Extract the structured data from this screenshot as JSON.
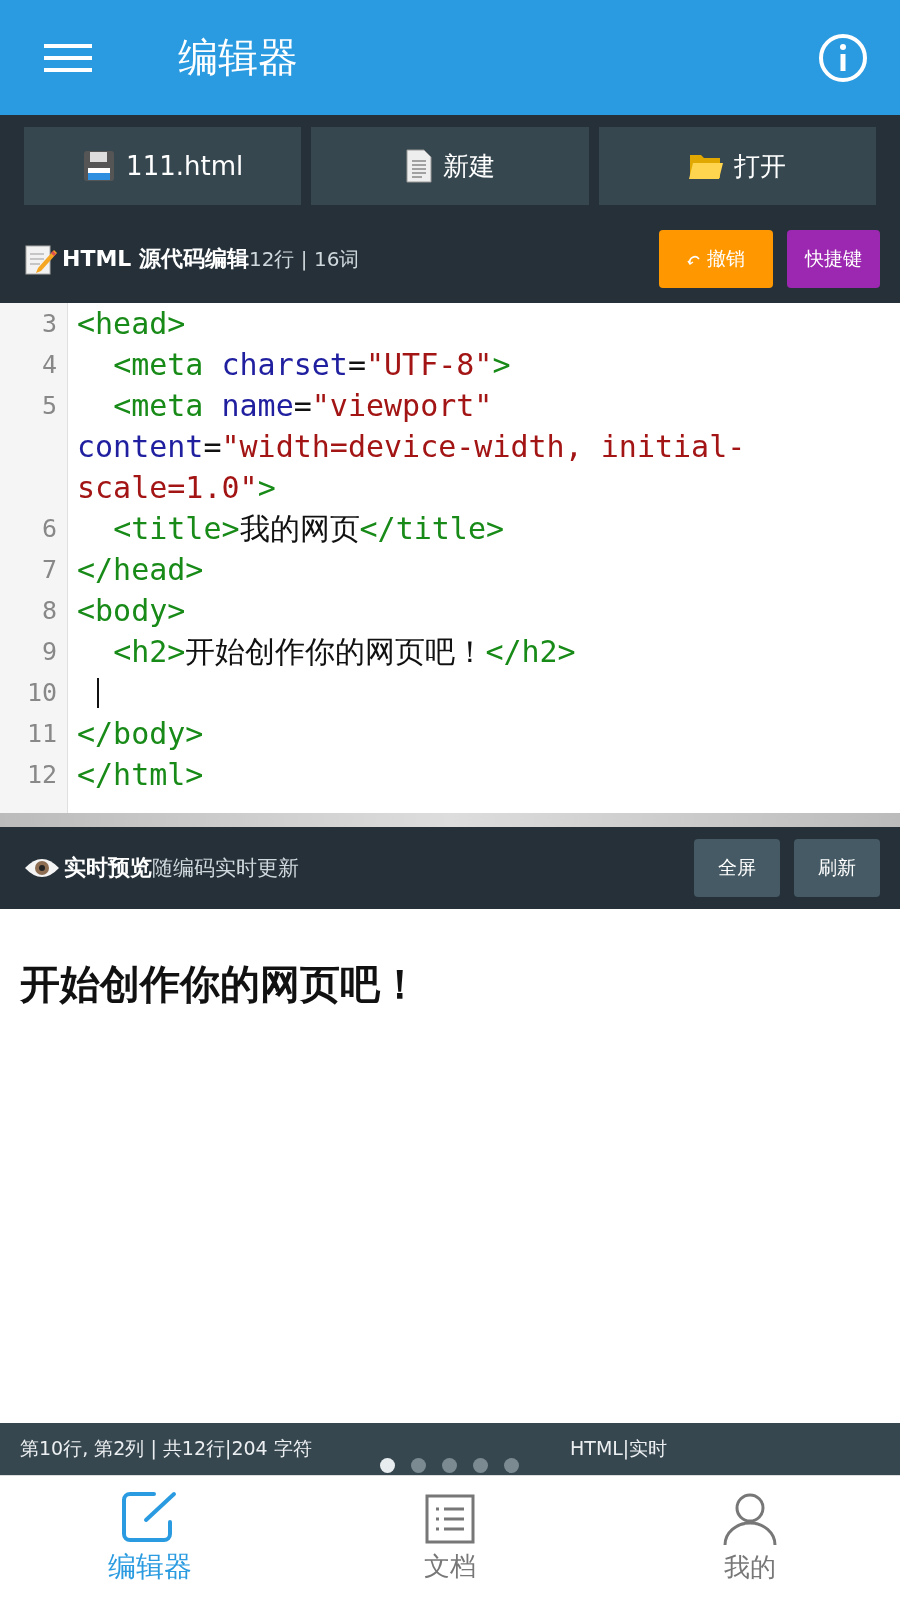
{
  "app_bar": {
    "title": "编辑器"
  },
  "toolbar": [
    {
      "label": "111.html",
      "kind": "save"
    },
    {
      "label": "新建",
      "kind": "new"
    },
    {
      "label": "打开",
      "kind": "open"
    }
  ],
  "editor": {
    "title": "HTML 源代码编辑",
    "stats": "12行 | 16词",
    "actions": [
      {
        "label": "撤销",
        "kind": "undo"
      },
      {
        "label": "快捷键",
        "kind": "shortcuts"
      }
    ],
    "lines": [
      {
        "number": "3",
        "cursor": false,
        "tokens": [
          {
            "kind": "tag",
            "text": "<head>"
          }
        ]
      },
      {
        "number": "4",
        "cursor": false,
        "tokens": [
          {
            "kind": "tag",
            "text": "  <meta"
          },
          {
            "kind": "attr",
            "text": " charset"
          },
          {
            "kind": "text",
            "text": "="
          },
          {
            "kind": "str",
            "text": "\"UTF-8\""
          },
          {
            "kind": "tag",
            "text": ">"
          }
        ]
      },
      {
        "number": "5",
        "cursor": false,
        "tokens": [
          {
            "kind": "tag",
            "text": "  <meta"
          },
          {
            "kind": "attr",
            "text": " name"
          },
          {
            "kind": "text",
            "text": "="
          },
          {
            "kind": "str",
            "text": "\"viewport\""
          },
          {
            "kind": "attr",
            "text": " content"
          },
          {
            "kind": "text",
            "text": "="
          },
          {
            "kind": "str",
            "text": "\"width=device-width, initial-scale=1.0\""
          },
          {
            "kind": "tag",
            "text": ">"
          }
        ]
      },
      {
        "number": "6",
        "cursor": false,
        "tokens": [
          {
            "kind": "tag",
            "text": "  <title>"
          },
          {
            "kind": "text",
            "text": "我的网页"
          },
          {
            "kind": "tag",
            "text": "</title>"
          }
        ]
      },
      {
        "number": "7",
        "cursor": false,
        "tokens": [
          {
            "kind": "tag",
            "text": "</head>"
          }
        ]
      },
      {
        "number": "8",
        "cursor": false,
        "tokens": [
          {
            "kind": "tag",
            "text": "<body>"
          }
        ]
      },
      {
        "number": "9",
        "cursor": false,
        "tokens": [
          {
            "kind": "tag",
            "text": "  <h2>"
          },
          {
            "kind": "text",
            "text": "开始创作你的网页吧！"
          },
          {
            "kind": "tag",
            "text": "</h2>"
          }
        ]
      },
      {
        "number": "10",
        "cursor": true
      },
      {
        "number": "11",
        "cursor": false,
        "tokens": [
          {
            "kind": "tag",
            "text": "</body>"
          }
        ]
      },
      {
        "number": "12",
        "cursor": false,
        "tokens": [
          {
            "kind": "tag",
            "text": "</html>"
          }
        ]
      }
    ]
  },
  "preview": {
    "title": "实时预览",
    "subtitle": "随编码实时更新",
    "actions": [
      "全屏",
      "刷新"
    ],
    "heading": "开始创作你的网页吧！"
  },
  "status_bar": {
    "position": "第10行, 第2列 | 共12行|204 字符",
    "mode": "HTML|实时"
  },
  "pager": [
    {
      "selected": true
    },
    {
      "selected": false
    },
    {
      "selected": false
    },
    {
      "selected": false
    },
    {
      "selected": false
    }
  ],
  "nav": [
    {
      "label": "编辑器",
      "kind": "editor",
      "selected": true
    },
    {
      "label": "文档",
      "kind": "docs",
      "selected": false
    },
    {
      "label": "我的",
      "kind": "profile",
      "selected": false
    }
  ]
}
